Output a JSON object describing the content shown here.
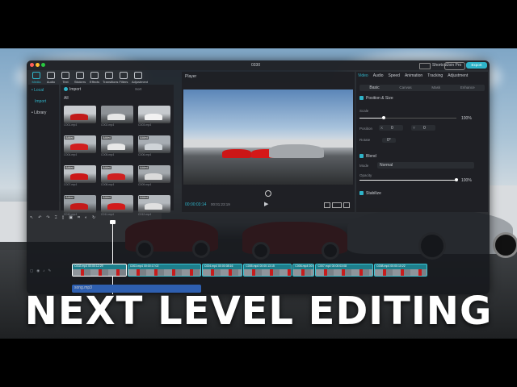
{
  "headline": "NEXT LEVEL EDITING",
  "window": {
    "project_name": "0330"
  },
  "top_actions": {
    "shortcut": "Shortcut",
    "join_pro": "Join Pro",
    "export": "Export"
  },
  "toolbar": [
    {
      "label": "Media",
      "icon": "media-icon"
    },
    {
      "label": "Audio",
      "icon": "audio-icon"
    },
    {
      "label": "Text",
      "icon": "text-icon"
    },
    {
      "label": "Stickers",
      "icon": "stickers-icon"
    },
    {
      "label": "Effects",
      "icon": "effects-icon"
    },
    {
      "label": "Transitions",
      "icon": "transitions-icon"
    },
    {
      "label": "Filters",
      "icon": "filters-icon"
    },
    {
      "label": "Adjustment",
      "icon": "adjustment-icon"
    }
  ],
  "media_sidebar": {
    "local": "• Local",
    "import": "Import",
    "library": "• Library"
  },
  "media_header": {
    "import_button": "Import",
    "filter_all": "All",
    "sort": "Sort"
  },
  "media_grid": [
    {
      "name": "C001.mp4",
      "badge": ""
    },
    {
      "name": "C002.mp4",
      "badge": ""
    },
    {
      "name": "C003.mp4",
      "badge": ""
    },
    {
      "name": "C004.mp4",
      "badge": "Added"
    },
    {
      "name": "C005.mp4",
      "badge": "Added"
    },
    {
      "name": "C006.mp4",
      "badge": "Added"
    },
    {
      "name": "C007.mp4",
      "badge": "Added"
    },
    {
      "name": "C008.mp4",
      "badge": "Added"
    },
    {
      "name": "C009.mp4",
      "badge": "Added"
    },
    {
      "name": "C010.mp4",
      "badge": "Added"
    },
    {
      "name": "C011.mp4",
      "badge": "Added"
    },
    {
      "name": "C012.mp4",
      "badge": "Added"
    }
  ],
  "player": {
    "title": "Player",
    "time_current": "00:00:03:14",
    "time_total": "00:01:23:19"
  },
  "inspector": {
    "tabs": [
      "Video",
      "Audio",
      "Speed",
      "Animation",
      "Tracking",
      "Adjustment"
    ],
    "subtabs": [
      "Basic",
      "Canvas",
      "Mask",
      "Enhance"
    ],
    "position_size": "Position & Size",
    "scale_label": "Scale",
    "scale_value": "100%",
    "scale_fraction": 0.25,
    "position_label": "Position",
    "pos_x_prefix": "X",
    "pos_x": "0",
    "pos_y_prefix": "Y",
    "pos_y": "0",
    "rotate_label": "Rotate",
    "rotate_value": "0°",
    "blend": "Blend",
    "mode_label": "Mode",
    "mode_value": "Normal",
    "opacity_label": "Opacity",
    "opacity_value": "100%",
    "opacity_fraction": 1.0,
    "stabilize": "Stabilize"
  },
  "timeline": {
    "clips": [
      {
        "label": "C002.mp4  00:00:12:29",
        "color": "#1d7f8c"
      },
      {
        "label": "C003.mp4  00:00:17:02",
        "color": "#1d7f8c"
      },
      {
        "label": "C004.mp4  00:00:08:16",
        "color": "#1d7f8c"
      },
      {
        "label": "C005.mp4  00:00:13:15",
        "color": "#1d7f8c"
      },
      {
        "label": "C006.mp4  00:00:02:09",
        "color": "#1d7f8c"
      },
      {
        "label": "C007.mp4  00:00:03:08",
        "color": "#1d7f8c"
      },
      {
        "label": "C008.mp4  00:00:10:22",
        "color": "#1d7f8c"
      }
    ],
    "audio_label": "song.mp3"
  },
  "colors": {
    "accent": "#2fb4c9",
    "panel": "#1e2024",
    "clip": "#1d7f8c"
  }
}
